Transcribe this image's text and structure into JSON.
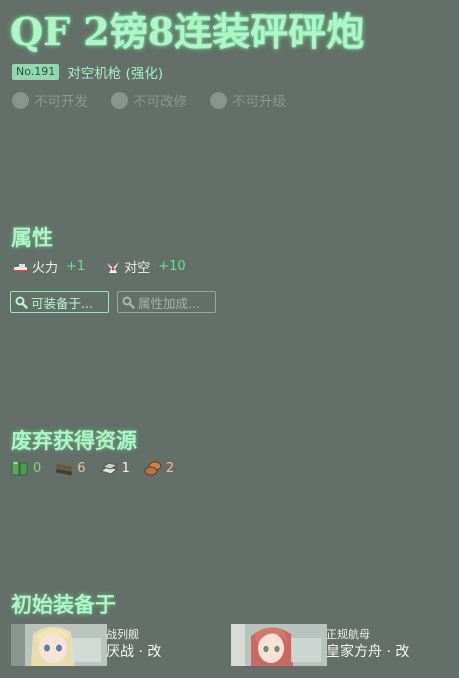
{
  "equipment": {
    "name": "QF 2镑8连装砰砰炮",
    "number": "No.191",
    "type": "对空机枪 (强化)"
  },
  "flags": [
    {
      "label": "不可开发"
    },
    {
      "label": "不可改修"
    },
    {
      "label": "不可升级"
    }
  ],
  "attributes": {
    "title": "属性",
    "stats": [
      {
        "icon": "firepower-icon",
        "label": "火力",
        "value": "+1"
      },
      {
        "icon": "anti-air-icon",
        "label": "对空",
        "value": "+10"
      }
    ],
    "buttons": [
      {
        "label": "可装备于..."
      },
      {
        "label": "属性加成..."
      }
    ]
  },
  "scrap": {
    "title": "废弃获得资源",
    "resources": [
      {
        "icon": "fuel-icon",
        "value": "0",
        "color": "#7fbf6a"
      },
      {
        "icon": "ammo-icon",
        "value": "6",
        "color": "#d9c28a"
      },
      {
        "icon": "steel-icon",
        "value": "1",
        "color": "#eef2ef"
      },
      {
        "icon": "bauxite-icon",
        "value": "2",
        "color": "#f0b98a"
      }
    ]
  },
  "initial": {
    "title": "初始装备于",
    "ships": [
      {
        "type": "战列舰",
        "name": "厌战 · 改"
      },
      {
        "type": "正规航母",
        "name": "皇家方舟 · 改"
      }
    ]
  }
}
